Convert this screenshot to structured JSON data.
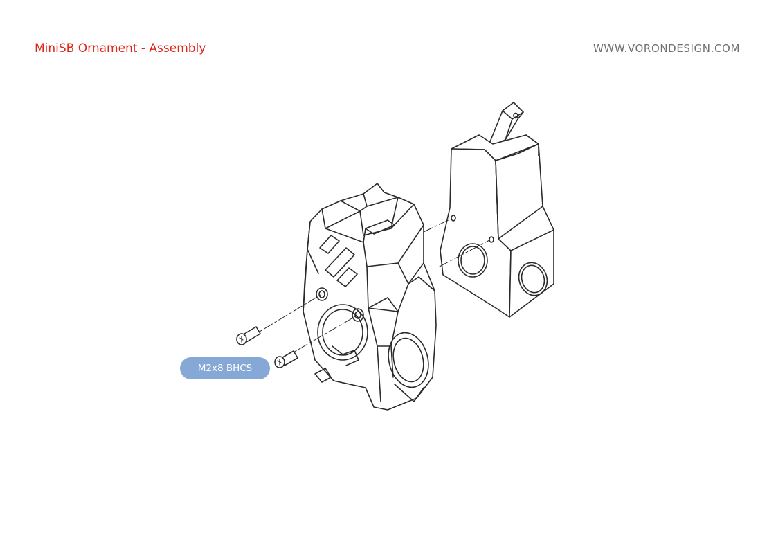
{
  "header": {
    "title": "MiniSB Ornament - Assembly",
    "website": "WWW.VORONDESIGN.COM"
  },
  "callouts": [
    {
      "label": "M2x8 BHCS"
    }
  ],
  "colors": {
    "title": "#e0261b",
    "website": "#6f6f6f",
    "callout_fill": "#86a8d6",
    "line_art": "#2a2a2a"
  }
}
